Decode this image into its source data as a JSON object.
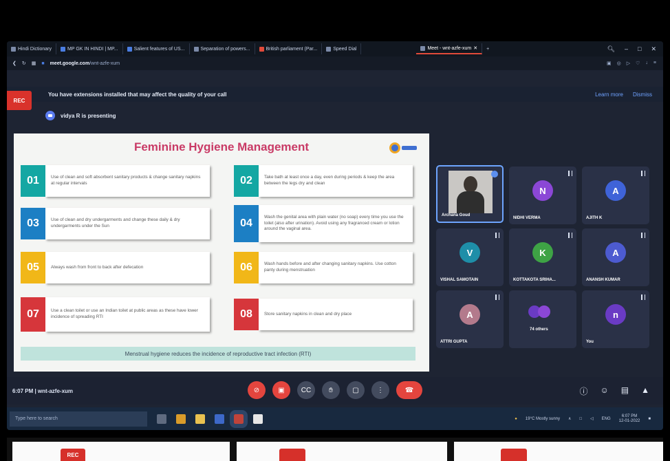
{
  "browser": {
    "tabs": [
      {
        "label": "Hindi Dictionary",
        "icon": "page-icon"
      },
      {
        "label": "MP GK IN HINDI | MP...",
        "icon": "page-icon"
      },
      {
        "label": "Salient features of US...",
        "icon": "page-icon"
      },
      {
        "label": "Separation of powers...",
        "icon": "page-icon"
      },
      {
        "label": "British parliament (Par...",
        "icon": "youtube-icon"
      },
      {
        "label": "Speed Dial",
        "icon": "page-icon"
      },
      {
        "label": "Meet - wnt-azfe-xum",
        "icon": "meet-icon",
        "active": true
      }
    ],
    "url_host": "meet.google.com",
    "url_path": "/wnt-azfe-xum"
  },
  "notice": {
    "rec_label": "REC",
    "message": "You have extensions installed that may affect the quality of your call",
    "learn_more": "Learn more",
    "dismiss": "Dismiss"
  },
  "presenting": {
    "text": "vidya R is presenting"
  },
  "slide": {
    "title": "Feminine Hygiene Management",
    "items": [
      {
        "num": "01",
        "text": "Use of clean and soft absorbent sanitary products & change sanitary napkins at regular intervals",
        "color": "#14a7a3"
      },
      {
        "num": "02",
        "text": "Take bath at least once a day, even during periods & keep the area between the legs dry and clean",
        "color": "#14a7a3"
      },
      {
        "num": "03",
        "text": "Use of clean and dry undergarments and change these daily & dry undergarments under the Sun",
        "color": "#1c7fc4"
      },
      {
        "num": "04",
        "text": "Wash the genital area with plain water (no soap) every time you use the toilet (also after urination). Avoid using any fragranced cream or lotion around the vaginal area.",
        "color": "#1c7fc4"
      },
      {
        "num": "05",
        "text": "Always wash from front to back after defecation",
        "color": "#f1b718"
      },
      {
        "num": "06",
        "text": "Wash hands before and after changing sanitary napkins. Use cotton panty during menstruation",
        "color": "#f1b718"
      },
      {
        "num": "07",
        "text": "Use a clean toilet or use an Indian toilet at public areas as these have lower incidence of spreading RTI",
        "color": "#d6363b"
      },
      {
        "num": "08",
        "text": "Store sanitary napkins in clean and dry place",
        "color": "#d6363b"
      }
    ],
    "footer": "Menstrual hygiene reduces the incidence of reproductive tract infection (RTI)"
  },
  "participants": [
    {
      "name": "Archana Goud",
      "initial": "",
      "video": true
    },
    {
      "name": "NIDHI VERMA",
      "initial": "N"
    },
    {
      "name": "AJITH K",
      "initial": "A"
    },
    {
      "name": "VISHAL SAMOTAIN",
      "initial": "V"
    },
    {
      "name": "KOTTAKOTA SRIHA...",
      "initial": "K"
    },
    {
      "name": "ANANSH KUMAR",
      "initial": "A"
    },
    {
      "name": "ATTRI GUPTA",
      "initial": "A"
    },
    {
      "name": "74 others",
      "initial": ""
    },
    {
      "name": "You",
      "initial": "n"
    }
  ],
  "meeting": {
    "info": "6:07 PM  |  wnt-azfe-xum"
  },
  "taskbar": {
    "search_placeholder": "Type here to search",
    "weather": "19°C Mostly sunny",
    "lang": "ENG",
    "time": "6:07 PM",
    "date": "12-01-2022"
  },
  "bottom": {
    "rec_label": "REC"
  }
}
